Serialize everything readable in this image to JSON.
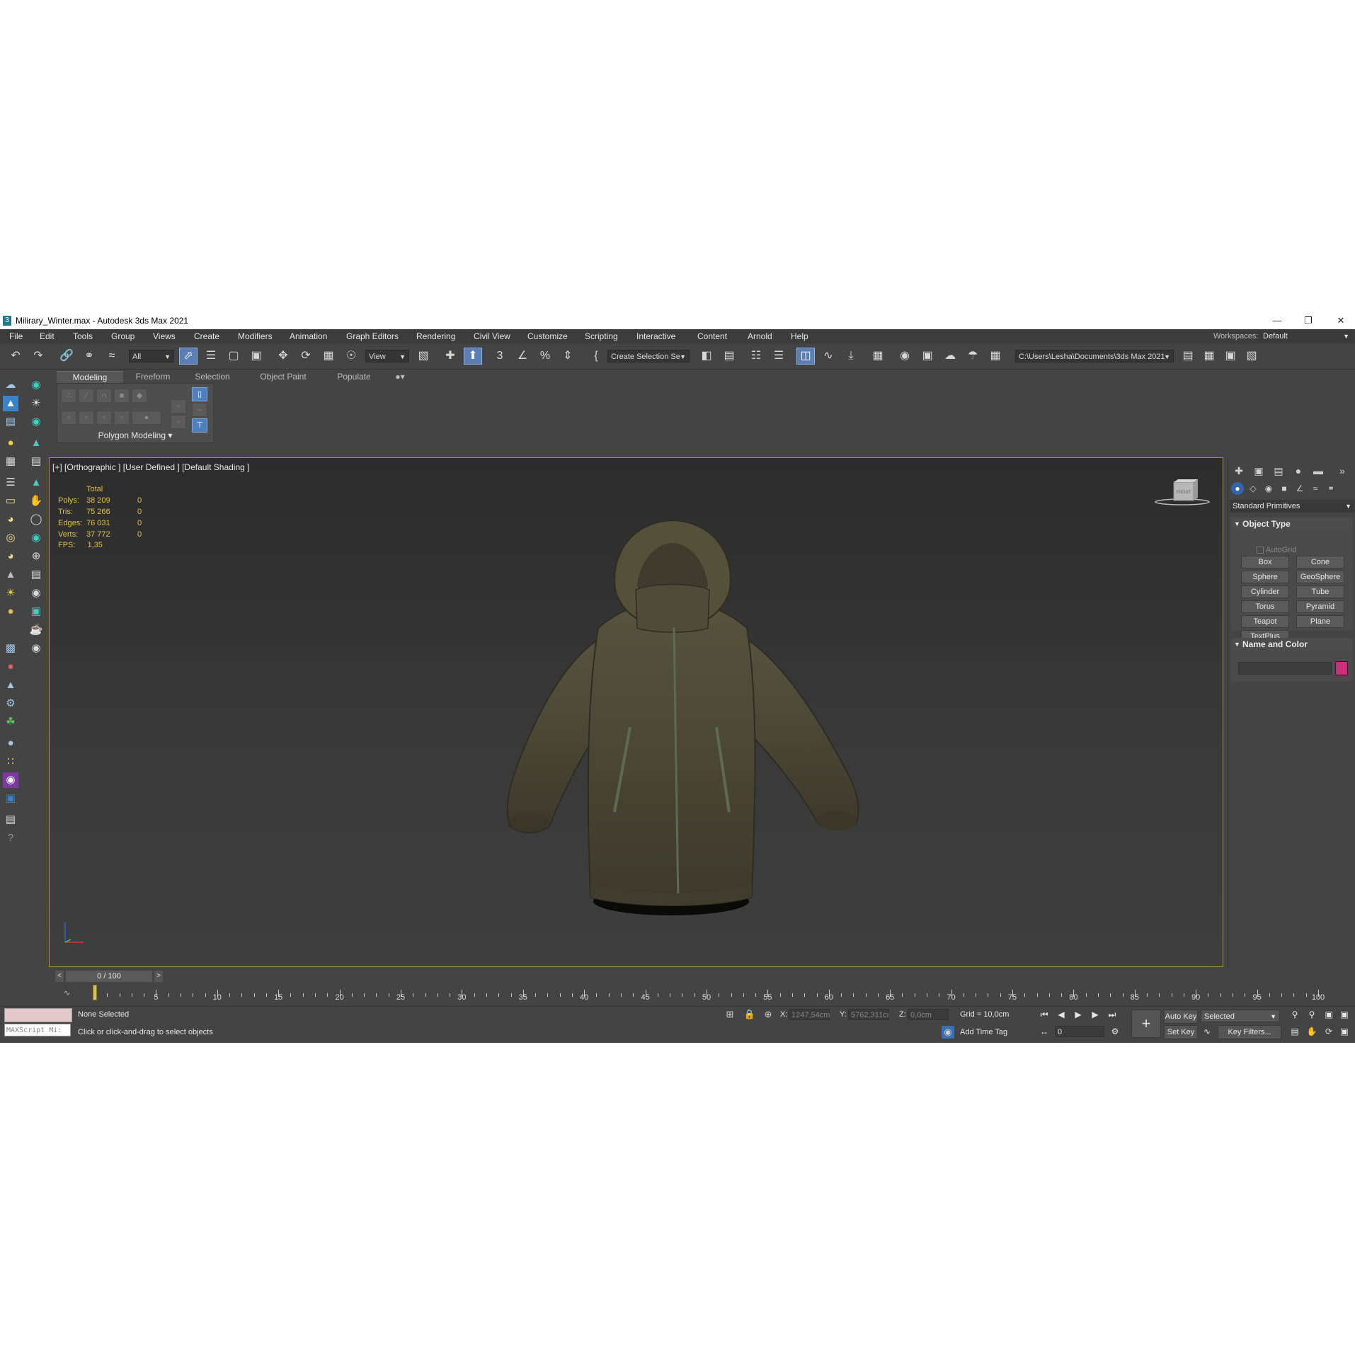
{
  "window": {
    "title": "Milirary_Winter.max - Autodesk 3ds Max 2021",
    "app_icon": "3",
    "controls": [
      "minimize-icon",
      "restore-icon",
      "close-icon"
    ]
  },
  "menu": {
    "items": [
      "File",
      "Edit",
      "Tools",
      "Group",
      "Views",
      "Create",
      "Modifiers",
      "Animation",
      "Graph Editors",
      "Rendering",
      "Civil View",
      "Customize",
      "Scripting",
      "Interactive",
      "Content",
      "Arnold",
      "Help"
    ],
    "workspace_label": "Workspaces:",
    "workspace_value": "Default"
  },
  "toolbar": {
    "selection_filter": "All",
    "ref_coord": "View",
    "named_selection": "Create Selection Se",
    "project_path": "C:\\Users\\Lesha\\Documents\\3ds Max 2021"
  },
  "ribbon": {
    "tabs": [
      "Modeling",
      "Freeform",
      "Selection",
      "Object Paint",
      "Populate"
    ],
    "active_tab": "Modeling",
    "panel_label": "Polygon Modeling"
  },
  "viewport": {
    "label": "[+] [Orthographic ] [User Defined ] [Default Shading ]",
    "stats": {
      "header": "Total",
      "rows": [
        {
          "label": "Polys:",
          "total": "38 209",
          "sel": "0"
        },
        {
          "label": "Tris:",
          "total": "75 266",
          "sel": "0"
        },
        {
          "label": "Edges:",
          "total": "76 031",
          "sel": "0"
        },
        {
          "label": "Verts:",
          "total": "37 772",
          "sel": "0"
        }
      ],
      "fps_label": "FPS:",
      "fps_value": "1,35"
    },
    "viewcube_face": "FRONT",
    "jacket_color": "#4a4736"
  },
  "command_panel": {
    "category": "Standard Primitives",
    "object_type": {
      "title": "Object Type",
      "autogrid": "AutoGrid",
      "buttons": [
        "Box",
        "Cone",
        "Sphere",
        "GeoSphere",
        "Cylinder",
        "Tube",
        "Torus",
        "Pyramid",
        "Teapot",
        "Plane",
        "TextPlus"
      ]
    },
    "name_and_color": {
      "title": "Name and Color",
      "color": "#c8307a"
    }
  },
  "timeline": {
    "position": "0 / 100",
    "prev": "<",
    "next": ">",
    "ticks": [
      "5",
      "10",
      "15",
      "20",
      "25",
      "30",
      "35",
      "40",
      "45",
      "50",
      "55",
      "60",
      "65",
      "70",
      "75",
      "80",
      "85",
      "90",
      "95",
      "100"
    ]
  },
  "status": {
    "selection": "None Selected",
    "prompt": "Click or click-and-drag to select objects",
    "maxscript": "MAXScript Mi:",
    "x_label": "X:",
    "x_value": "1247,54cm",
    "y_label": "Y:",
    "y_value": "5762,311cı",
    "z_label": "Z:",
    "z_value": "0,0cm",
    "grid": "Grid = 10,0cm",
    "add_time_tag": "Add Time Tag",
    "auto_key": "Auto Key",
    "set_key": "Set Key",
    "selected_dropdown": "Selected",
    "key_filters": "Key Filters...",
    "frame": "0"
  }
}
